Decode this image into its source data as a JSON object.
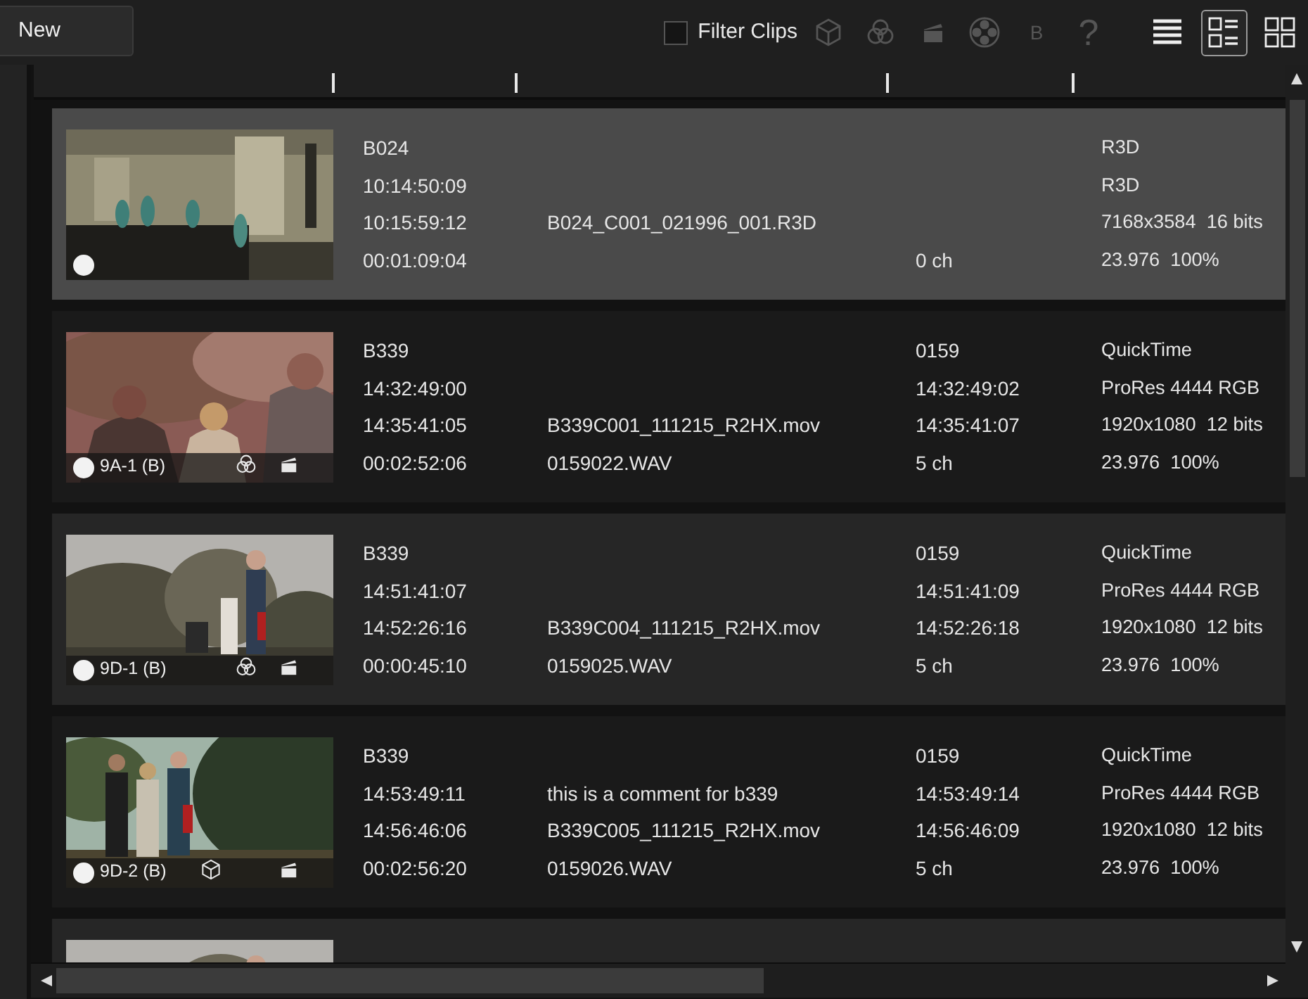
{
  "toolbar": {
    "new_button": "New",
    "filter": {
      "label": "Filter Clips",
      "checked": false
    },
    "tools": [
      {
        "kind": "cube",
        "disabled": true
      },
      {
        "kind": "color",
        "disabled": true
      },
      {
        "kind": "clapper",
        "disabled": true
      },
      {
        "kind": "reel",
        "disabled": true
      },
      {
        "kind": "text",
        "label": "B",
        "disabled": true
      },
      {
        "kind": "text",
        "label": "?",
        "disabled": true
      }
    ],
    "view_modes": [
      {
        "kind": "list",
        "selected": false
      },
      {
        "kind": "details",
        "selected": true
      },
      {
        "kind": "grid",
        "selected": false
      }
    ]
  },
  "clips": [
    {
      "selected": true,
      "kind": "picture",
      "badges": {
        "color": false,
        "cube": false,
        "clapper": false
      },
      "video": [
        "B024",
        "10:14:50:09",
        "10:15:59:12",
        "00:01:09:04"
      ],
      "files": {
        "file": "B024_C001_021996_001.R3D"
      },
      "audio": {
        "channels": "0 ch"
      },
      "format": [
        "R3D",
        "R3D",
        "7168x3584  16 bits",
        "23.976  100%"
      ]
    },
    {
      "selected": false,
      "kind": "picture",
      "label": "9A-1 (B)",
      "badges": {
        "color": true,
        "cube": false,
        "clapper": true
      },
      "video": [
        "B339",
        "14:32:49:00",
        "14:35:41:05",
        "00:02:52:06"
      ],
      "files": {
        "file": "B339C001_111215_R2HX.mov",
        "audio_file": "0159022.WAV"
      },
      "audio": {
        "reel": "0159",
        "start": "14:32:49:02",
        "end": "14:35:41:07",
        "channels": "5 ch"
      },
      "format": [
        "QuickTime",
        "ProRes 4444 RGB",
        "1920x1080  12 bits",
        "23.976  100%"
      ]
    },
    {
      "selected": false,
      "kind": "picture",
      "label": "9D-1 (B)",
      "badges": {
        "color": true,
        "cube": false,
        "clapper": true
      },
      "video": [
        "B339",
        "14:51:41:07",
        "14:52:26:16",
        "00:00:45:10"
      ],
      "files": {
        "file": "B339C004_111215_R2HX.mov",
        "audio_file": "0159025.WAV"
      },
      "audio": {
        "reel": "0159",
        "start": "14:51:41:09",
        "end": "14:52:26:18",
        "channels": "5 ch"
      },
      "format": [
        "QuickTime",
        "ProRes 4444 RGB",
        "1920x1080  12 bits",
        "23.976  100%"
      ]
    },
    {
      "selected": false,
      "kind": "picture",
      "label": "9D-2 (B)",
      "badges": {
        "color": false,
        "cube": true,
        "clapper": true
      },
      "video": [
        "B339",
        "14:53:49:11",
        "14:56:46:06",
        "00:02:56:20"
      ],
      "files": {
        "comment": "this is a comment for b339",
        "file": "B339C005_111215_R2HX.mov",
        "audio_file": "0159026.WAV"
      },
      "audio": {
        "reel": "0159",
        "start": "14:53:49:14",
        "end": "14:56:46:09",
        "channels": "5 ch"
      },
      "format": [
        "QuickTime",
        "ProRes 4444 RGB",
        "1920x1080  12 bits",
        "23.976  100%"
      ]
    },
    {
      "selected": false,
      "kind": "picture"
    }
  ]
}
